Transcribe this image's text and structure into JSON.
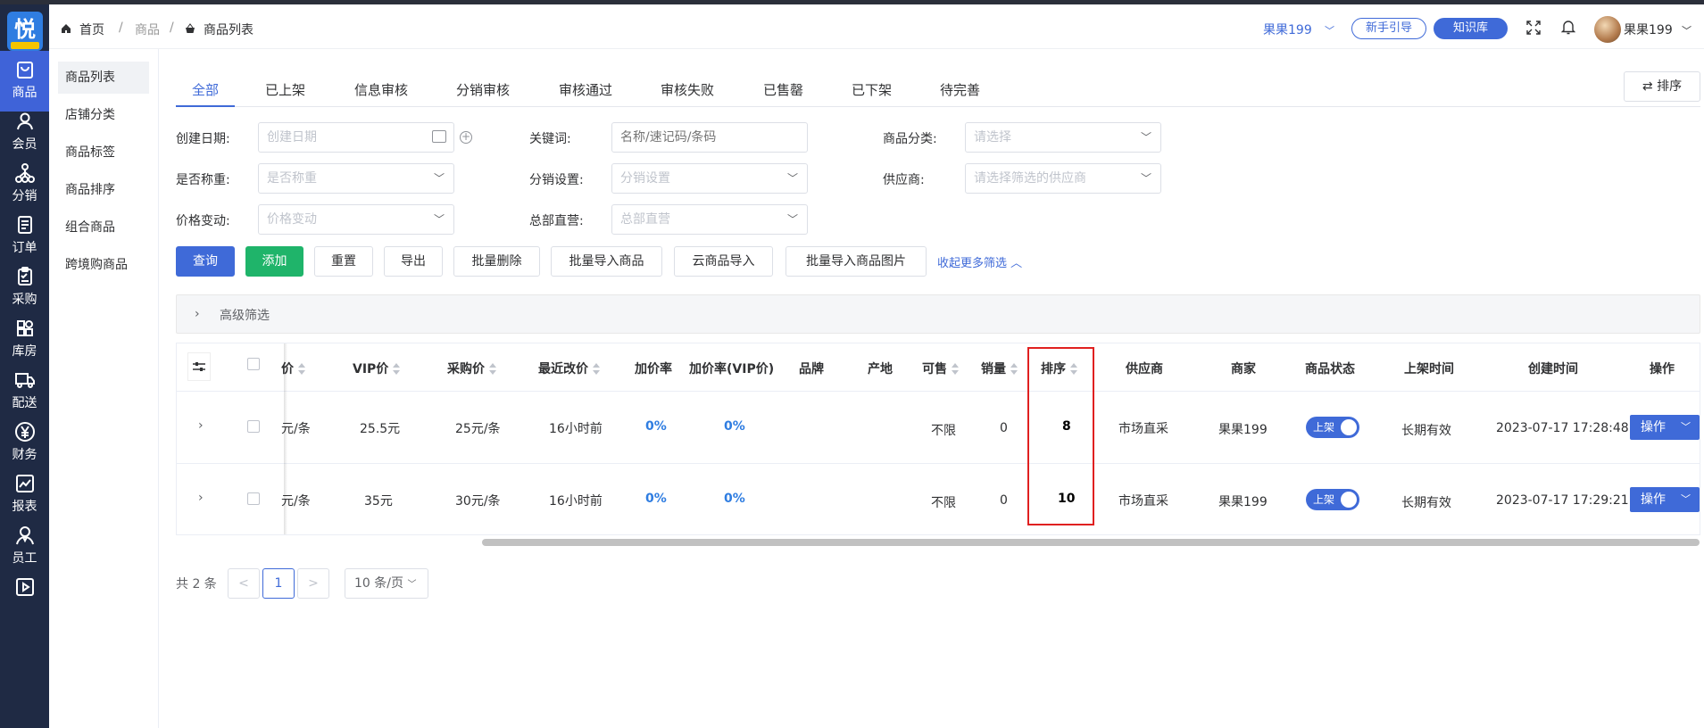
{
  "header": {
    "home": "首页",
    "crumb_goods": "商品",
    "crumb_current": "商品列表",
    "store": "果果199",
    "guide": "新手引导",
    "knowledge": "知识库",
    "user": "果果199"
  },
  "rail": [
    {
      "label": "商品",
      "icon": "bag-icon"
    },
    {
      "label": "会员",
      "icon": "user-icon"
    },
    {
      "label": "分销",
      "icon": "network-icon"
    },
    {
      "label": "订单",
      "icon": "document-icon"
    },
    {
      "label": "采购",
      "icon": "clipboard-icon"
    },
    {
      "label": "库房",
      "icon": "grid-icon"
    },
    {
      "label": "配送",
      "icon": "truck-icon"
    },
    {
      "label": "财务",
      "icon": "yen-icon"
    },
    {
      "label": "报表",
      "icon": "chart-icon"
    },
    {
      "label": "员工",
      "icon": "staff-icon"
    },
    {
      "label": "",
      "icon": "play-icon"
    }
  ],
  "sidebar": [
    "商品列表",
    "店铺分类",
    "商品标签",
    "商品排序",
    "组合商品",
    "跨境购商品"
  ],
  "tabs": [
    "全部",
    "已上架",
    "信息审核",
    "分销审核",
    "审核通过",
    "审核失败",
    "已售罄",
    "已下架",
    "待完善"
  ],
  "sort_button": "排序",
  "filters": {
    "create_date_label": "创建日期:",
    "create_date_ph": "创建日期",
    "keyword_label": "关键词:",
    "keyword_ph": "名称/速记码/条码",
    "category_label": "商品分类:",
    "category_ph": "请选择",
    "weigh_label": "是否称重:",
    "weigh_ph": "是否称重",
    "dist_label": "分销设置:",
    "dist_ph": "分销设置",
    "supplier_label": "供应商:",
    "supplier_ph": "请选择筛选的供应商",
    "price_label": "价格变动:",
    "price_ph": "价格变动",
    "hq_label": "总部直营:",
    "hq_ph": "总部直营"
  },
  "buttons": {
    "query": "查询",
    "add": "添加",
    "reset": "重置",
    "export": "导出",
    "batch_delete": "批量删除",
    "batch_import": "批量导入商品",
    "cloud_import": "云商品导入",
    "batch_import_img": "批量导入商品图片",
    "collapse": "收起更多筛选"
  },
  "advanced": "高级筛选",
  "table": {
    "headers": {
      "price": "价",
      "vip": "VIP价",
      "purchase": "采购价",
      "recent": "最近改价",
      "markup": "加价率",
      "markup_vip": "加价率(VIP价)",
      "brand": "品牌",
      "origin": "产地",
      "sellable": "可售",
      "sales": "销量",
      "sort": "排序",
      "supplier": "供应商",
      "merchant": "商家",
      "status": "商品状态",
      "shelf_time": "上架时间",
      "create_time": "创建时间",
      "op": "操作"
    },
    "rows": [
      {
        "price": "元/条",
        "vip": "25.5元",
        "purchase": "25元/条",
        "recent": "16小时前",
        "markup": "0%",
        "markup_vip": "0%",
        "sellable": "不限",
        "sales": "0",
        "sort": "8",
        "supplier": "市场直采",
        "merchant": "果果199",
        "status": "上架",
        "shelf_time": "长期有效",
        "create_time": "2023-07-17 17:28:48",
        "op": "操作"
      },
      {
        "price": "元/条",
        "vip": "35元",
        "purchase": "30元/条",
        "recent": "16小时前",
        "markup": "0%",
        "markup_vip": "0%",
        "sellable": "不限",
        "sales": "0",
        "sort": "10",
        "supplier": "市场直采",
        "merchant": "果果199",
        "status": "上架",
        "shelf_time": "长期有效",
        "create_time": "2023-07-17 17:29:21",
        "op": "操作"
      }
    ]
  },
  "pagination": {
    "total": "共 2 条",
    "prev": "<",
    "page": "1",
    "next": ">",
    "size": "10 条/页"
  },
  "colors": {
    "primary": "#3f6ad8",
    "success": "#1fb46a",
    "rail": "#1f2a44",
    "highlight": "#e02020"
  }
}
